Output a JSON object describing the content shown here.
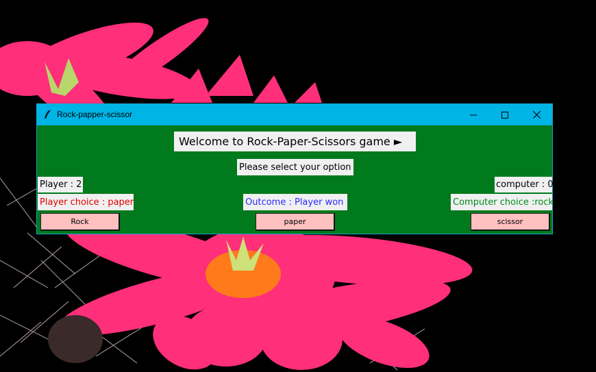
{
  "window": {
    "title": "Rock-papper-scissor",
    "feather_icon": "feather-icon",
    "controls": {
      "minimize": "minimize-icon",
      "maximize": "maximize-icon",
      "close": "close-icon"
    }
  },
  "game": {
    "welcome": "Welcome to Rock-Paper-Scissors game ►",
    "instruction": "Please select your option",
    "player_score": "Player : 2",
    "computer_score": "computer : 0",
    "player_choice": "Player choice : paper",
    "outcome": "Outcome :  Player won",
    "computer_choice": "Computer choice :rock",
    "buttons": {
      "rock": "Rock",
      "paper": "paper",
      "scissor": "scissor"
    }
  },
  "colors": {
    "window_bg": "#007a1c",
    "titlebar": "#00b4e6",
    "label_bg": "#f0f0f0",
    "button_bg": "#ffc0c0",
    "player_choice": "#e00000",
    "outcome": "#2a2aff",
    "computer_choice": "#008a1c"
  }
}
